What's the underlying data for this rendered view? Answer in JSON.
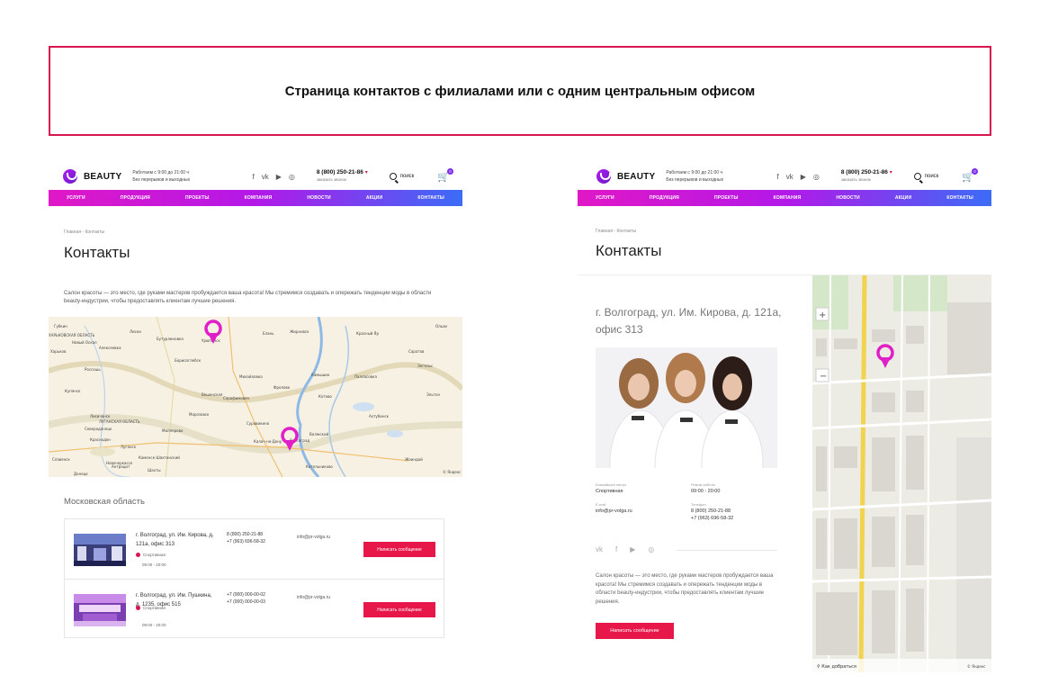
{
  "banner": {
    "title": "Страница контактов с филиалами или с одним центральным офисом"
  },
  "left": {
    "header": {
      "logo": "BEAUTY",
      "hours_line1": "Работаем с 9:00 до 21:00 ч",
      "hours_line2": "Без перерывов и выходных",
      "socials": [
        "f",
        "vk",
        "▶",
        "◎"
      ],
      "phone": "8 (800) 250-21-86",
      "callback": "заказать звонок",
      "search": "поиск",
      "cart_count": "0"
    },
    "nav": [
      "УСЛУГИ",
      "ПРОДУКЦИЯ",
      "ПРОЕКТЫ",
      "КОМПАНИЯ",
      "НОВОСТИ",
      "АКЦИИ",
      "КОНТАКТЫ"
    ],
    "breadcrumb": "Главная - Контакты",
    "title": "Контакты",
    "lead": "Салон красоты — это место, где руками мастеров пробуждается ваша красота! Мы стремимся создавать и опережать тенденции моды в области beauty-индустрии, чтобы предоставлять клиентам лучшие решения.",
    "map_labels": [
      "Губкин",
      "Новый Оскол",
      "Алексеевка",
      "Россошь",
      "Бутурлиновка",
      "Лиски",
      "Урюпинск",
      "Елань",
      "Борисоглебск",
      "Жирновск",
      "Красный Яр",
      "Ольхи",
      "Камышин",
      "Михайловка",
      "Фролово",
      "Котово",
      "Серафимович",
      "Вешенская",
      "Морозовск",
      "Суровикино",
      "Калач-на-Дону",
      "Волгоград",
      "Волжский",
      "Палласовка",
      "Эльтон",
      "Луганск",
      "Миллерово",
      "Каменск-Шахтинский",
      "Шахты",
      "Новочеркасск",
      "Донецк",
      "Краснодон",
      "Антрацит",
      "Харьков",
      "Купянск",
      "Северодонецк",
      "Лисичанск",
      "Славянск",
      "ЛУГАНСКАЯ ОБЛАСТЬ",
      "ХАРЬКОВСКАЯ ОБЛАСТЬ",
      "Котельниково",
      "Ахтубинск",
      "Жаиндай",
      "Саратов",
      "Энгельс"
    ],
    "map_copyright": "© Яндекс",
    "region": "Московская область",
    "branches": [
      {
        "address": "г. Волгоград, ул. Им. Кирова, д. 121а, офис 313",
        "metro": "Спортивная",
        "time": "09:00 - 20:00",
        "phone1": "8 (800) 250-21-88",
        "phone2": "+7 (963) 696-58-32",
        "email": "info@pr-volga.ru",
        "button": "Написать сообщение"
      },
      {
        "address": "г. Волгоград, ул. Им. Пушкина, д. 1235, офис 515",
        "metro": "Спортивная",
        "time": "09:00 - 20:00",
        "phone1": "+7 (000) 000-00-02",
        "phone2": "+7 (000) 000-00-03",
        "email": "info@pr-volga.ru",
        "button": "Написать сообщение"
      }
    ]
  },
  "right": {
    "header": {
      "logo": "BEAUTY",
      "hours_line1": "Работаем с 9:00 до 21:00 ч",
      "hours_line2": "Без перерывов и выходных",
      "socials": [
        "f",
        "vk",
        "▶",
        "◎"
      ],
      "phone": "8 (800) 250-21-86",
      "callback": "заказать звонок",
      "search": "поиск",
      "cart_count": "0"
    },
    "nav": [
      "УСЛУГИ",
      "ПРОДУКЦИЯ",
      "ПРОЕКТЫ",
      "КОМПАНИЯ",
      "НОВОСТИ",
      "АКЦИИ",
      "КОНТАКТЫ"
    ],
    "breadcrumb": "Главная - Контакты",
    "title": "Контакты",
    "address": "г. Волгоград, ул. Им. Кирова, д. 121а, офис 313",
    "info": {
      "metro_label": "Ближайшее метро",
      "metro_value": "Спортивная",
      "hours_label": "Режим работы",
      "hours_value": "09:00 - 20:00",
      "email_label": "E-mail",
      "email_value": "info@pr-volga.ru",
      "phone_label": "Телефон",
      "phone_value1": "8 (800) 250-21-88",
      "phone_value2": "+7 (963) 696-58-32"
    },
    "socials": [
      "vk",
      "f",
      "▶",
      "◎"
    ],
    "description": "Салон красоты — это место, где руками мастеров пробуждается ваша красота! Мы стремимся создавать и опережать тенденции моды в области beauty-индустрии, чтобы предоставлять клиентам лучшие решения.",
    "button": "Написать сообщение",
    "map_route": "Как добраться",
    "map_copyright": "© Яндекс"
  }
}
